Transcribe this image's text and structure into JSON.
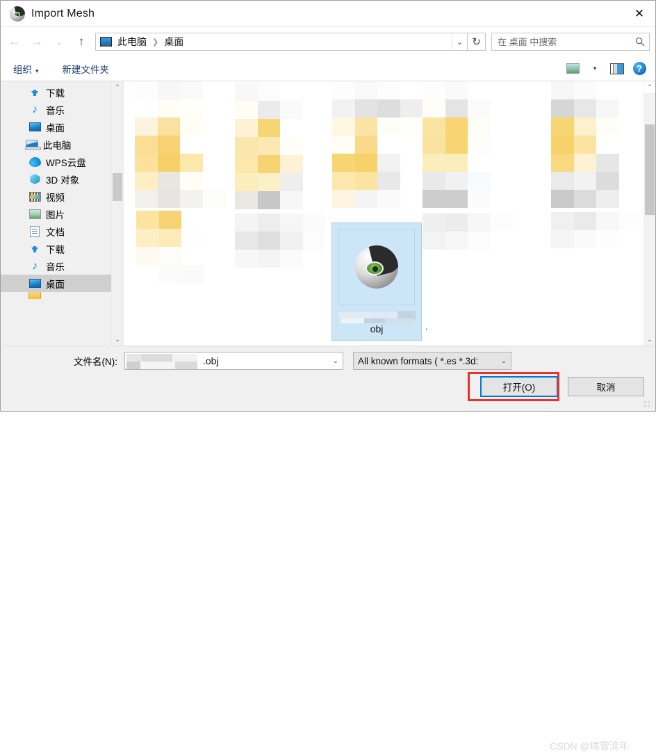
{
  "window": {
    "title": "Import Mesh",
    "title_icon": "meshlab-eye-icon",
    "close_label": "✕"
  },
  "navbar": {
    "back_icon": "arrow-left-icon",
    "forward_icon": "arrow-right-icon",
    "recent_icon": "chevron-down-icon",
    "up_icon": "arrow-up-icon",
    "breadcrumb": {
      "root_icon": "this-pc-icon",
      "separator": "❯",
      "items": [
        "此电脑",
        "桌面"
      ]
    },
    "address_chevron": "chevron-down-icon",
    "refresh_icon": "refresh-icon",
    "search": {
      "placeholder": "在 桌面 中搜索",
      "value": "",
      "icon": "search-icon"
    }
  },
  "toolbar": {
    "organize_label": "组织",
    "organize_caret": "▾",
    "new_folder_label": "新建文件夹",
    "view_icon": "view-layout-icon",
    "view_caret": "▾",
    "preview_pane_icon": "preview-pane-icon",
    "help_icon": "help-icon",
    "help_label": "?"
  },
  "sidebar": {
    "items": [
      {
        "label": "下载",
        "icon": "download-icon",
        "indent": 1,
        "selected": false
      },
      {
        "label": "音乐",
        "icon": "music-icon",
        "indent": 1,
        "selected": false
      },
      {
        "label": "桌面",
        "icon": "desktop-icon",
        "indent": 1,
        "selected": false
      },
      {
        "label": "此电脑",
        "icon": "this-pc-icon",
        "indent": 0,
        "selected": false
      },
      {
        "label": "WPS云盘",
        "icon": "wps-cloud-icon",
        "indent": 1,
        "selected": false
      },
      {
        "label": "3D 对象",
        "icon": "3d-objects-icon",
        "indent": 1,
        "selected": false
      },
      {
        "label": "视频",
        "icon": "video-icon",
        "indent": 1,
        "selected": false
      },
      {
        "label": "图片",
        "icon": "pictures-icon",
        "indent": 1,
        "selected": false
      },
      {
        "label": "文档",
        "icon": "documents-icon",
        "indent": 1,
        "selected": false
      },
      {
        "label": "下载",
        "icon": "download-icon",
        "indent": 1,
        "selected": false
      },
      {
        "label": "音乐",
        "icon": "music-icon",
        "indent": 1,
        "selected": false
      },
      {
        "label": "桌面",
        "icon": "desktop-icon",
        "indent": 1,
        "selected": true
      },
      {
        "label": "",
        "icon": "folder-icon",
        "indent": 1,
        "selected": false
      }
    ],
    "scrollbar": {
      "up_icon": "chevron-up-icon",
      "down_icon": "chevron-down-icon"
    }
  },
  "filelist": {
    "view_mode": "large-icons",
    "censored_note": "blurred-thumbnails",
    "selected_item": {
      "name": "obj",
      "icon": "meshlab-eye-icon",
      "selected": true
    },
    "scrollbar": {
      "up_icon": "chevron-up-icon",
      "down_icon": "chevron-down-icon"
    }
  },
  "footer": {
    "filename_label": "文件名(N):",
    "filename_value": ".obj",
    "filename_caret": "⌄",
    "filter_value": "All known formats ( *.es *.3d:",
    "filter_caret": "⌄",
    "open_button": "打开(O)",
    "cancel_button": "取消"
  },
  "overlay": {
    "watermark": "CSDN @瑞雪流年",
    "annotation_color": "#e8322c",
    "focus_color": "#0078d7"
  }
}
